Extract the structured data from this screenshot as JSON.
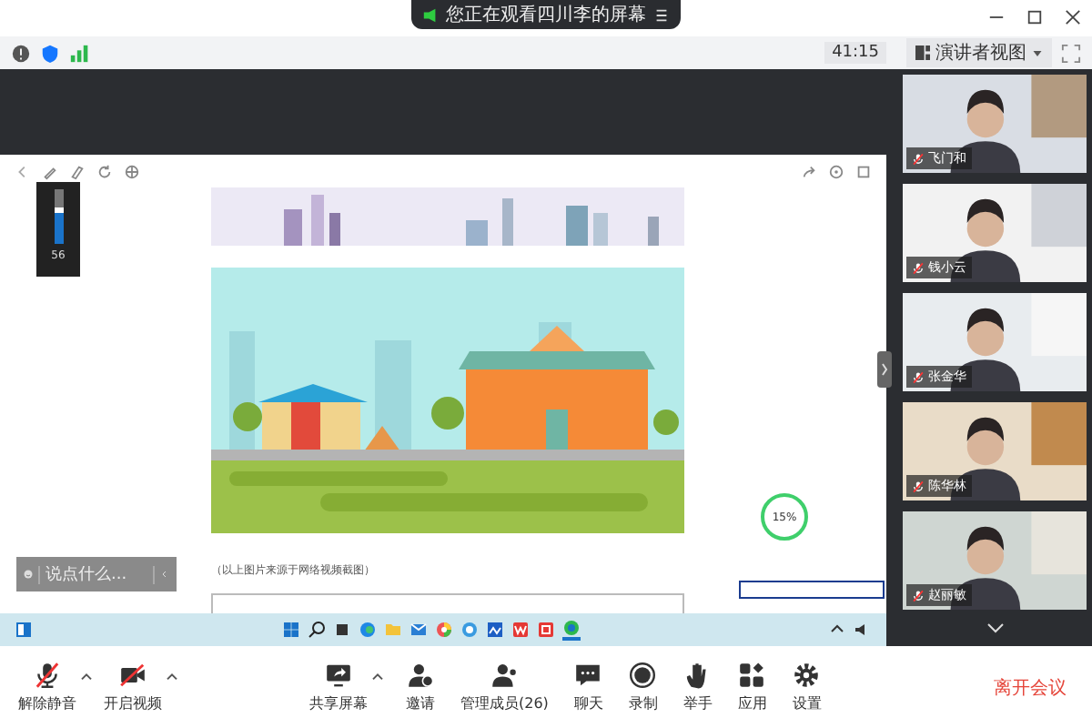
{
  "window": {
    "title": "您正在观看四川李的屏幕"
  },
  "topbar": {
    "timer": "41:15",
    "view_button": "演讲者视图"
  },
  "shared_screen": {
    "volume": {
      "level": 0.56,
      "reading": "56"
    },
    "caption": "（以上图片来源于网络视频截图）",
    "progress": "15%",
    "chat": {
      "placeholder": "说点什么..."
    }
  },
  "participants": [
    {
      "name": "飞门和",
      "muted": true
    },
    {
      "name": "钱小云",
      "muted": true
    },
    {
      "name": "张金华",
      "muted": true
    },
    {
      "name": "陈华林",
      "muted": true
    },
    {
      "name": "赵丽敏",
      "muted": true
    }
  ],
  "toolbar_left": [
    {
      "kind": "mic",
      "label": "解除静音",
      "caret": true
    },
    {
      "kind": "camera",
      "label": "开启视频",
      "caret": true
    }
  ],
  "toolbar_center": [
    {
      "kind": "share",
      "label": "共享屏幕",
      "caret": true
    },
    {
      "kind": "invite",
      "label": "邀请",
      "caret": false
    },
    {
      "kind": "members",
      "label": "管理成员(26)",
      "caret": false
    },
    {
      "kind": "chat",
      "label": "聊天",
      "caret": false
    },
    {
      "kind": "record",
      "label": "录制",
      "caret": false
    },
    {
      "kind": "hand",
      "label": "举手",
      "caret": false
    },
    {
      "kind": "apps",
      "label": "应用",
      "caret": false
    },
    {
      "kind": "settings",
      "label": "设置",
      "caret": false
    }
  ],
  "leave_button": "离开会议"
}
